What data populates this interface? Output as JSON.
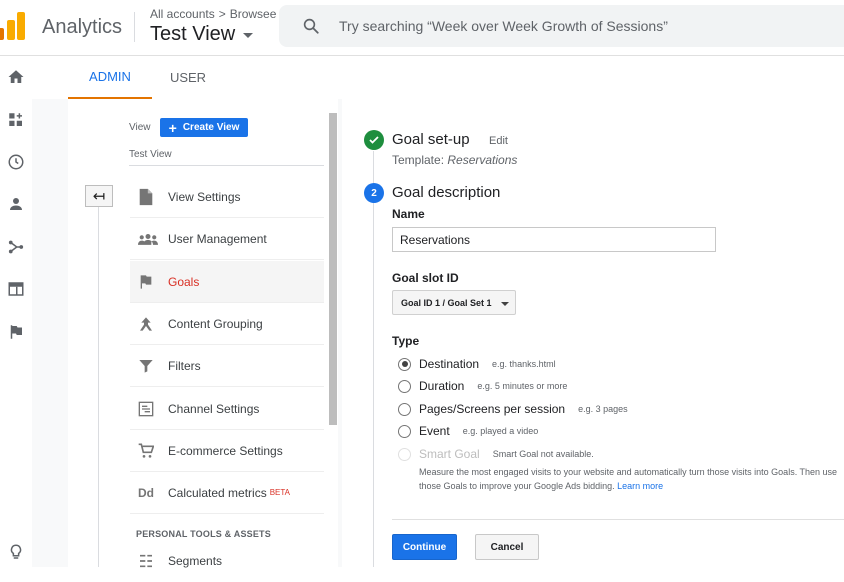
{
  "header": {
    "app_title": "Analytics",
    "breadcrumb": [
      "All accounts",
      "Browsee"
    ],
    "breadcrumb_separator": ">",
    "current_view": "Test View",
    "search_placeholder": "Try searching “Week over Week Growth of Sessions”"
  },
  "left_nav": {
    "icons": [
      "home-icon",
      "customization-icon",
      "realtime-icon",
      "audience-icon",
      "acquisition-icon",
      "behavior-icon",
      "conversions-icon",
      "lightbulb-icon"
    ]
  },
  "tabs": [
    {
      "label": "ADMIN",
      "active": true
    },
    {
      "label": "USER",
      "active": false
    }
  ],
  "view_panel": {
    "view_label": "View",
    "create_button": "Create View",
    "view_name": "Test View",
    "menu": [
      {
        "label": "View Settings",
        "icon": "document-icon",
        "active": false
      },
      {
        "label": "User Management",
        "icon": "users-icon",
        "active": false
      },
      {
        "label": "Goals",
        "icon": "flag-icon",
        "active": true
      },
      {
        "label": "Content Grouping",
        "icon": "content-grouping-icon",
        "active": false
      },
      {
        "label": "Filters",
        "icon": "filter-icon",
        "active": false
      },
      {
        "label": "Channel Settings",
        "icon": "channel-settings-icon",
        "active": false
      },
      {
        "label": "E-commerce Settings",
        "icon": "cart-icon",
        "active": false
      },
      {
        "label": "Calculated metrics",
        "badge": "BETA",
        "icon": "dd-icon",
        "active": false
      }
    ],
    "section_header": "PERSONAL TOOLS & ASSETS",
    "section_items": [
      {
        "label": "Segments",
        "icon": "segments-icon"
      }
    ]
  },
  "goal_setup": {
    "title": "Goal set-up",
    "edit_label": "Edit",
    "template_prefix": "Template:",
    "template_value": "Reservations"
  },
  "goal_description": {
    "step_number": "2",
    "title": "Goal description",
    "name_label": "Name",
    "name_value": "Reservations",
    "slot_label": "Goal slot ID",
    "slot_value": "Goal ID 1 / Goal Set 1",
    "type_label": "Type",
    "types": [
      {
        "label": "Destination",
        "hint": "e.g. thanks.html",
        "selected": true,
        "disabled": false
      },
      {
        "label": "Duration",
        "hint": "e.g. 5 minutes or more",
        "selected": false,
        "disabled": false
      },
      {
        "label": "Pages/Screens per session",
        "hint": "e.g. 3 pages",
        "selected": false,
        "disabled": false
      },
      {
        "label": "Event",
        "hint": "e.g. played a video",
        "selected": false,
        "disabled": false
      },
      {
        "label": "Smart Goal",
        "hint": "Smart Goal not available.",
        "selected": false,
        "disabled": true
      }
    ],
    "smart_goal_desc": "Measure the most engaged visits to your website and automatically turn those visits into Goals. Then use those Goals to improve your Google Ads bidding.",
    "learn_more": "Learn more",
    "continue_button": "Continue",
    "cancel_button": "Cancel"
  },
  "colors": {
    "accent": "#1a73e8",
    "active_menu": "#d93025",
    "success": "#1e8e3e",
    "logo_orange": "#e37400",
    "logo_yellow": "#f9ab00"
  }
}
